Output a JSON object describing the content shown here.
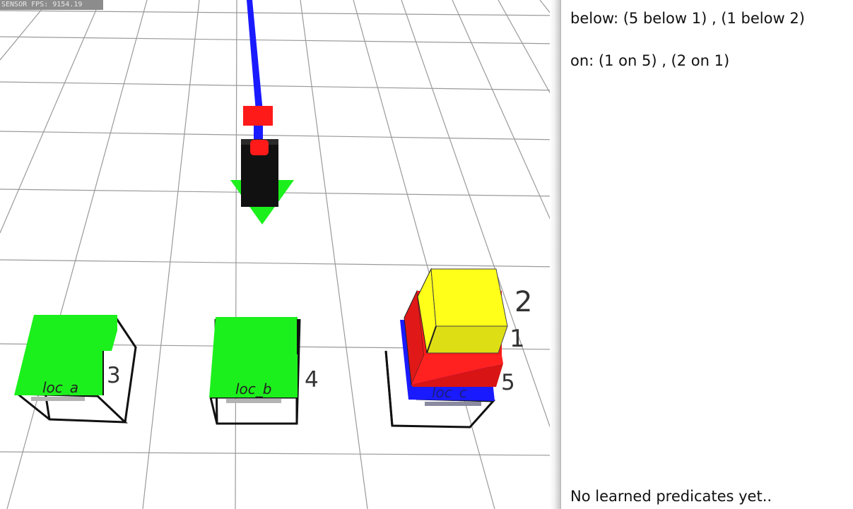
{
  "sensor": {
    "fps_label": "SENSOR FPS: 9154.19"
  },
  "scene": {
    "locations": [
      {
        "id": "loc_a",
        "label": "loc_a",
        "block_number": "3",
        "color": "#1cf01c"
      },
      {
        "id": "loc_b",
        "label": "loc_b",
        "block_number": "4",
        "color": "#1cf01c"
      },
      {
        "id": "loc_c",
        "label": "loc_c",
        "block_number": "5",
        "color": "#1a1aff"
      }
    ],
    "stack_labels": {
      "block_1": "1",
      "block_2": "2"
    },
    "colors": {
      "arm": "#1a1aff",
      "joint": "#ff1a1a",
      "gripper": "#111111",
      "marker": "#1cf01c",
      "block_red": "#ff1a1a",
      "block_yellow": "#ffff1a"
    }
  },
  "panel": {
    "below": "below: (5 below 1) , (1 below 2)",
    "on": "on: (1 on 5) , (2 on 1)",
    "learned": "No learned predicates yet.."
  }
}
